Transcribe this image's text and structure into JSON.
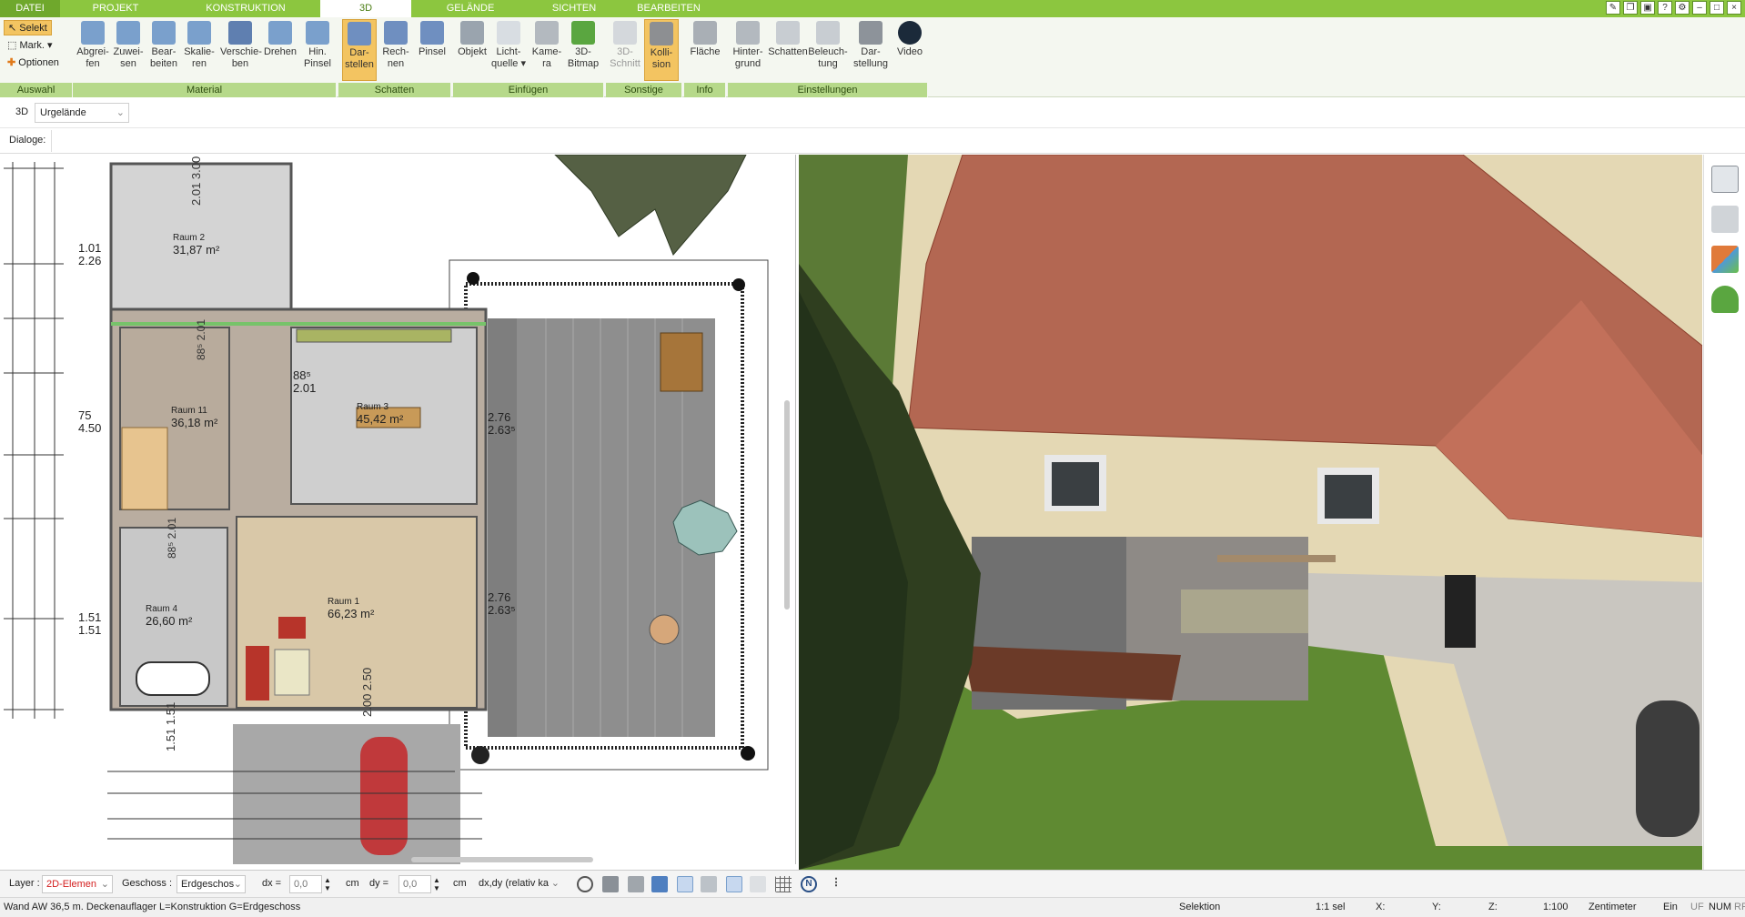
{
  "tabs": [
    {
      "label": "DATEI"
    },
    {
      "label": "PROJEKT"
    },
    {
      "label": "KONSTRUKTION"
    },
    {
      "label": "3D"
    },
    {
      "label": "GELÄNDE"
    },
    {
      "label": "SICHTEN"
    },
    {
      "label": "BEARBEITEN"
    }
  ],
  "ribbon": {
    "selection": {
      "selekt": "Selekt",
      "mark": "Mark.",
      "optionen": "Optionen"
    },
    "groups": [
      {
        "label": "Auswahl"
      },
      {
        "label": "Material"
      },
      {
        "label": "Schatten"
      },
      {
        "label": "Einfügen"
      },
      {
        "label": "Sonstige"
      },
      {
        "label": "Info"
      },
      {
        "label": "Einstellungen"
      }
    ],
    "buttons": [
      {
        "l1": "Abgrei-",
        "l2": "fen"
      },
      {
        "l1": "Zuwei-",
        "l2": "sen"
      },
      {
        "l1": "Bear-",
        "l2": "beiten"
      },
      {
        "l1": "Skalie-",
        "l2": "ren"
      },
      {
        "l1": "Verschie-",
        "l2": "ben"
      },
      {
        "l1": "Drehen",
        "l2": ""
      },
      {
        "l1": "Hin.",
        "l2": "Pinsel"
      },
      {
        "l1": "Dar-",
        "l2": "stellen"
      },
      {
        "l1": "Rech-",
        "l2": "nen"
      },
      {
        "l1": "Pinsel",
        "l2": ""
      },
      {
        "l1": "Objekt",
        "l2": ""
      },
      {
        "l1": "Licht-",
        "l2": "quelle"
      },
      {
        "l1": "Kame-",
        "l2": "ra"
      },
      {
        "l1": "3D-",
        "l2": "Bitmap"
      },
      {
        "l1": "3D-",
        "l2": "Schnitt"
      },
      {
        "l1": "Kolli-",
        "l2": "sion"
      },
      {
        "l1": "Fläche",
        "l2": ""
      },
      {
        "l1": "Hinter-",
        "l2": "grund"
      },
      {
        "l1": "Schatten",
        "l2": ""
      },
      {
        "l1": "Beleuch-",
        "l2": "tung"
      },
      {
        "l1": "Dar-",
        "l2": "stellung"
      },
      {
        "l1": "Video",
        "l2": ""
      }
    ]
  },
  "bar2": {
    "view_label": "3D",
    "terrain_value": "Urgelände"
  },
  "bar3": {
    "dialoge_label": "Dialoge:"
  },
  "plan": {
    "rooms": [
      {
        "name": "Raum 2",
        "area": "31,87 m²"
      },
      {
        "name": "Raum 11",
        "area": "36,18 m²"
      },
      {
        "name": "Raum 3",
        "area": "45,42 m²"
      },
      {
        "name": "Raum 4",
        "area": "26,60 m²"
      },
      {
        "name": "Raum 1",
        "area": "66,23 m²"
      }
    ],
    "dims": {
      "d1": "1.01",
      "d2": "2.26",
      "d3": "75",
      "d4": "4.50",
      "d5": "1.51",
      "d6": "1.51",
      "d7": "2.01",
      "d8": "3.00",
      "d9": "2.76",
      "d10": "2.63⁵",
      "d11": "2.76",
      "d12": "2.63⁵",
      "d13": "88⁵",
      "d14": "2.01",
      "d15": "88⁵",
      "d16": "2.01",
      "d17": "88⁵",
      "d18": "2.01",
      "d19": "2.00",
      "d20": "2.50",
      "d21": "1.51",
      "d22": "1.51"
    }
  },
  "bottombar": {
    "layer_label": "Layer :",
    "layer_value": "2D-Elemen",
    "geschoss_label": "Geschoss :",
    "geschoss_value": "Erdgeschos",
    "dx_label": "dx =",
    "dx_value": "0,0",
    "dx_unit": "cm",
    "dy_label": "dy =",
    "dy_value": "0,0",
    "dy_unit": "cm",
    "mode_value": "dx,dy (relativ ka"
  },
  "status": {
    "message": "Wand AW 36,5 m. Deckenauflager L=Konstruktion G=Erdgeschoss",
    "mode": "Selektion",
    "sel": "1:1 sel",
    "x": "X:",
    "y": "Y:",
    "z": "Z:",
    "scale": "1:100",
    "unit": "Zentimeter",
    "ein": "Ein",
    "uf": "UF",
    "num": "NUM",
    "rf": "RF"
  },
  "colors": {
    "brand": "#8cc63f",
    "group_label": "#b6d98a",
    "active_button": "#f3c461"
  }
}
